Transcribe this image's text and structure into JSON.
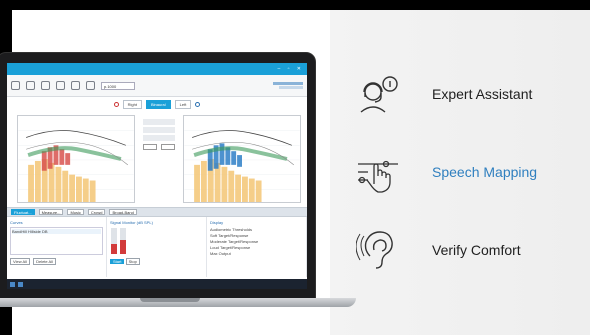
{
  "features": [
    {
      "label": "Expert Assistant",
      "icon": "headset-agent-icon",
      "active": false
    },
    {
      "label": "Speech Mapping",
      "icon": "hand-sliders-icon",
      "active": true
    },
    {
      "label": "Verify Comfort",
      "icon": "ear-icon",
      "active": false
    }
  ],
  "app": {
    "program_select": "p.1000",
    "ear_tabs": [
      "Right",
      "Binaural",
      "Left"
    ],
    "stimulus_options": [
      "Fluctuat...",
      "Measure...",
      "Music",
      "Crowd",
      "Broad-Band"
    ],
    "bottom": {
      "curves_title": "Curves",
      "curve_header": [
        "Pers.",
        "Curve Label",
        "Visibility"
      ],
      "curve_row": "BandHill Hillside DB",
      "view_all": "View All",
      "delete_all": "Delete All",
      "signal_title": "Signal Monitor (dB SPL)",
      "start_btn": "Start",
      "stop_btn": "Stop",
      "display_title": "Display",
      "display_select": "Input + Gain",
      "checks": [
        "Audiometric Thresholds",
        "Soft Target/Response",
        "Moderate Target/Response",
        "Loud Target/Response",
        "Max Output"
      ],
      "integrated": "Integrated Speech Mapping"
    }
  }
}
